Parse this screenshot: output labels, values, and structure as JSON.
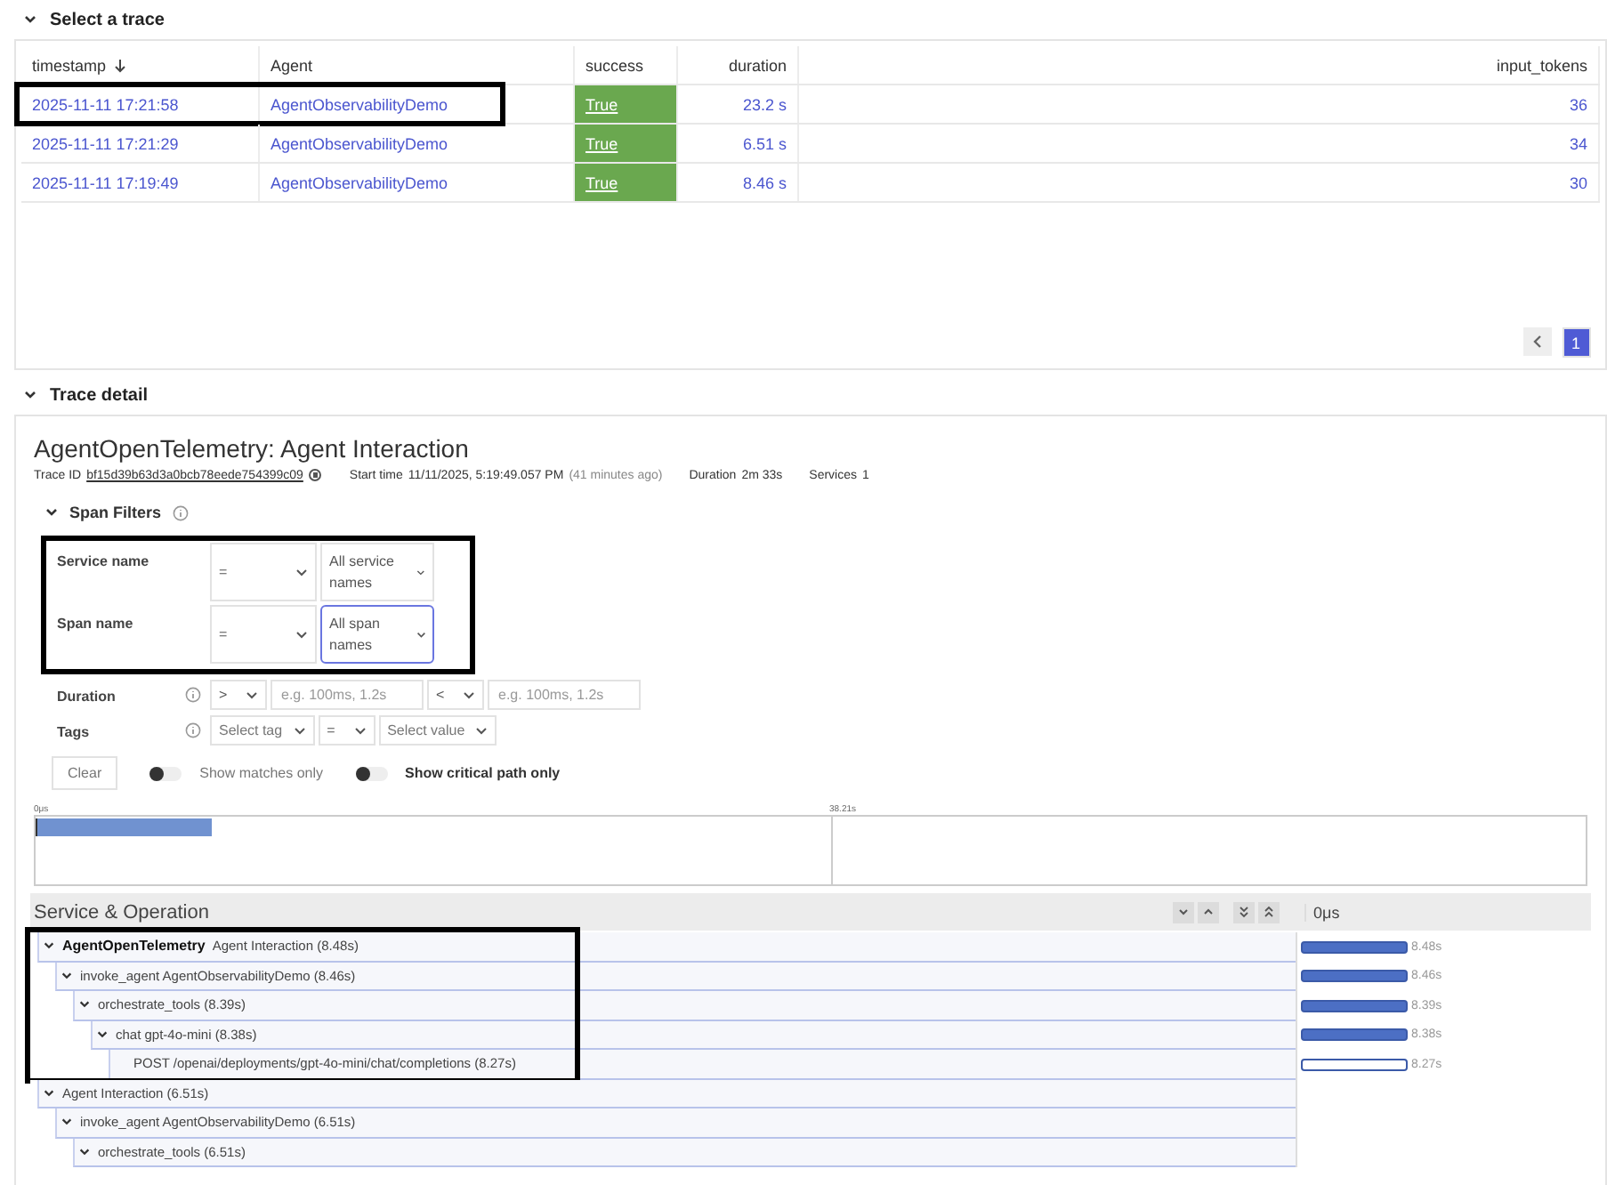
{
  "trace_list": {
    "title": "Select a trace",
    "expanded": true,
    "columns": [
      {
        "label": "timestamp",
        "sorted": true
      },
      {
        "label": "Agent",
        "sorted": false
      },
      {
        "label": "success",
        "sorted": false
      },
      {
        "label": "duration",
        "sorted": false
      },
      {
        "label": "input_tokens",
        "sorted": false
      }
    ],
    "rows": [
      {
        "timestamp": "2025-11-11 17:21:58",
        "agent": "AgentObservabilityDemo",
        "success": "True",
        "duration": "23.2 s",
        "input_tokens": "36",
        "highlighted": true
      },
      {
        "timestamp": "2025-11-11 17:21:29",
        "agent": "AgentObservabilityDemo",
        "success": "True",
        "duration": "6.51 s",
        "input_tokens": "34",
        "highlighted": false
      },
      {
        "timestamp": "2025-11-11 17:19:49",
        "agent": "AgentObservabilityDemo",
        "success": "True",
        "duration": "8.46 s",
        "input_tokens": "30",
        "highlighted": false
      }
    ],
    "pages": [
      {
        "label": "1",
        "selected": true
      }
    ]
  },
  "trace_detail": {
    "title": "Trace detail",
    "expanded": true,
    "heading": "AgentOpenTelemetry: Agent Interaction",
    "trace_id_label": "Trace ID",
    "trace_id": "bf15d39b63d3a0bcb78eede754399c09",
    "start_time_label": "Start time",
    "start_time": "11/11/2025, 5:19:49.057 PM",
    "start_time_ago": "(41 minutes ago)",
    "duration_label": "Duration",
    "duration": "2m 33s",
    "services_label": "Services",
    "services": "1",
    "span_filters": {
      "title": "Span Filters",
      "expanded": true,
      "filters": [
        {
          "kind": "select",
          "label": "Service name",
          "operator": "=",
          "value": "All service names",
          "highlighted": true,
          "focused": false
        },
        {
          "kind": "select",
          "label": "Span name",
          "operator": "=",
          "value": "All span names",
          "highlighted": true,
          "focused": true
        },
        {
          "kind": "range",
          "label": "Duration",
          "min_operator": ">",
          "min_placeholder": "e.g. 100ms, 1.2s",
          "max_operator": "<",
          "max_placeholder": "e.g. 100ms, 1.2s",
          "highlighted": false
        },
        {
          "kind": "tag",
          "label": "Tags",
          "tag_placeholder": "Select tag",
          "operator": "=",
          "value_placeholder": "Select value",
          "highlighted": false
        }
      ],
      "clear_button": "Clear",
      "toggles": [
        {
          "label": "Show matches only",
          "on": false,
          "emphasized": false
        },
        {
          "label": "Show critical path only",
          "on": false,
          "emphasized": true
        }
      ]
    },
    "minimap": {
      "start_label": "0μs",
      "mid_label": "38.21s"
    },
    "span_table": {
      "header": "Service & Operation",
      "timeline_start": "0μs",
      "spans": [
        {
          "service": "AgentOpenTelemetry",
          "operation": "Agent Interaction (8.48s)",
          "expanded": true,
          "highlighted": true,
          "bar_label": "8.48s",
          "outlined": false,
          "children": [
            {
              "operation": "invoke_agent AgentObservabilityDemo (8.46s)",
              "expanded": true,
              "bar_label": "8.46s",
              "outlined": false,
              "children": [
                {
                  "operation": "orchestrate_tools (8.39s)",
                  "expanded": true,
                  "bar_label": "8.39s",
                  "outlined": false,
                  "children": [
                    {
                      "operation": "chat gpt-4o-mini (8.38s)",
                      "expanded": true,
                      "bar_label": "8.38s",
                      "outlined": false,
                      "children": [
                        {
                          "operation": "POST /openai/deployments/gpt-4o-mini/chat/completions (8.27s)",
                          "bar_label": "8.27s",
                          "outlined": true
                        }
                      ]
                    }
                  ]
                }
              ]
            }
          ]
        },
        {
          "operation": "Agent Interaction (6.51s)",
          "expanded": true,
          "highlighted": false,
          "children": [
            {
              "operation": "invoke_agent AgentObservabilityDemo (6.51s)",
              "expanded": true,
              "children": [
                {
                  "operation": "orchestrate_tools (6.51s)",
                  "expanded": true
                }
              ]
            }
          ]
        }
      ]
    }
  }
}
